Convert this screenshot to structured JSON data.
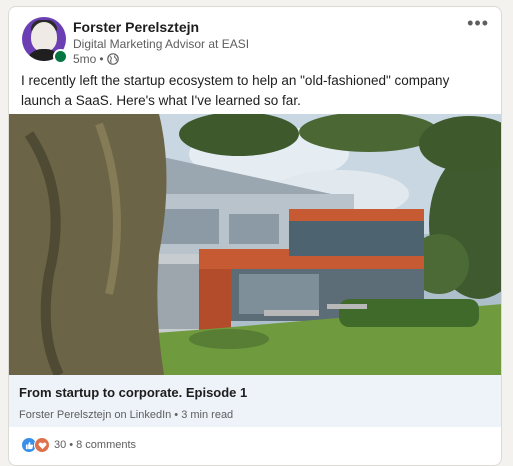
{
  "post": {
    "author_name": "Forster Perelsztejn",
    "author_headline": "Digital Marketing Advisor at EASI",
    "time_ago": "5mo",
    "separator": "•",
    "visibility_icon": "globe-icon",
    "more_label": "•••",
    "text": "I recently left the startup ecosystem to help an \"old-fashioned\" company launch a SaaS. Here's what I've learned so far."
  },
  "article": {
    "title": "From startup to corporate. Episode 1",
    "source": "Forster Perelsztejn on LinkedIn • 3 min read"
  },
  "social": {
    "reaction_icons": [
      "like-icon",
      "love-icon"
    ],
    "reactions_count": "30",
    "comments": "8 comments",
    "dot": "•"
  },
  "colors": {
    "like": "#378fe9",
    "love": "#df704d",
    "online": "#057642",
    "avatar_bg": "#6b3fb3",
    "article_bg": "#edf3f8"
  }
}
